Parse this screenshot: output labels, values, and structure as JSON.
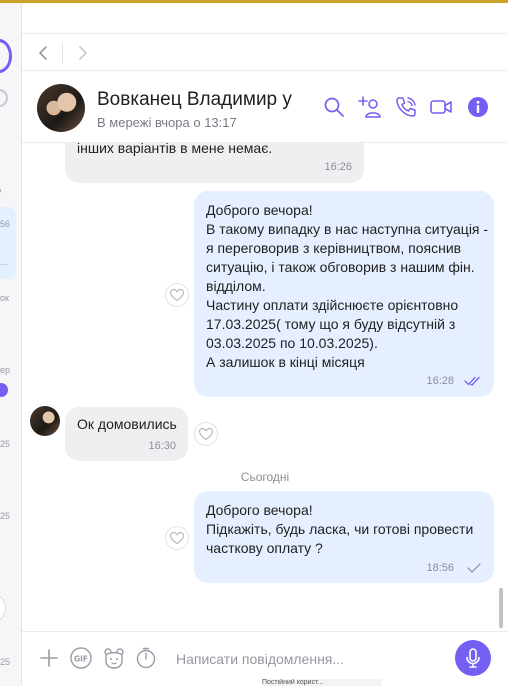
{
  "contact": {
    "name": "Вовканец Владимир у",
    "status": "В мережі вчора о 13:17"
  },
  "sidebar": {
    "peek_texts": [
      "56",
      "...",
      "ок",
      "ер",
      "25",
      "25",
      "25"
    ]
  },
  "messages": [
    {
      "direction": "in",
      "text": "інших варіантів в мене немає.",
      "time": "16:26"
    },
    {
      "direction": "out",
      "text": "Доброго вечора!\nВ такому випадку в нас наступна ситуація -\nя переговорив з керівництвом, пояснив\nситуацію, і також обговорив з нашим фін.\nвідділом.\nЧастину оплати здійснюєте орієнтовно\n17.03.2025( тому що я буду відсутній з\n03.03.2025 по 10.03.2025).\nА залишок в кінці місяця",
      "time": "16:28",
      "status": "read"
    },
    {
      "direction": "in",
      "text": "Ок домовились",
      "time": "16:30"
    },
    {
      "direction": "out",
      "text": "Доброго вечора!\nПідкажіть, будь ласка, чи готові провести\nчасткову оплату ?",
      "time": "18:56",
      "status": "delivered"
    }
  ],
  "date_separator": "Сьогодні",
  "composer": {
    "placeholder": "Написати повідомлення..."
  },
  "bottom_peek": "Постійний корист...",
  "icons": {
    "search": "search-icon",
    "add_participant": "add-participant-icon",
    "call": "phone-icon",
    "video": "video-call-icon",
    "info": "info-icon",
    "plus": "plus-icon",
    "gif": "gif-icon",
    "sticker": "sticker-icon",
    "timer": "timer-icon",
    "mic": "microphone-icon"
  },
  "colors": {
    "accent": "#7360f2",
    "outgoing_bubble": "#e6efff",
    "incoming_bubble": "#efeff2",
    "read_tick": "#7360f2",
    "top_strip": "#c9a227"
  }
}
